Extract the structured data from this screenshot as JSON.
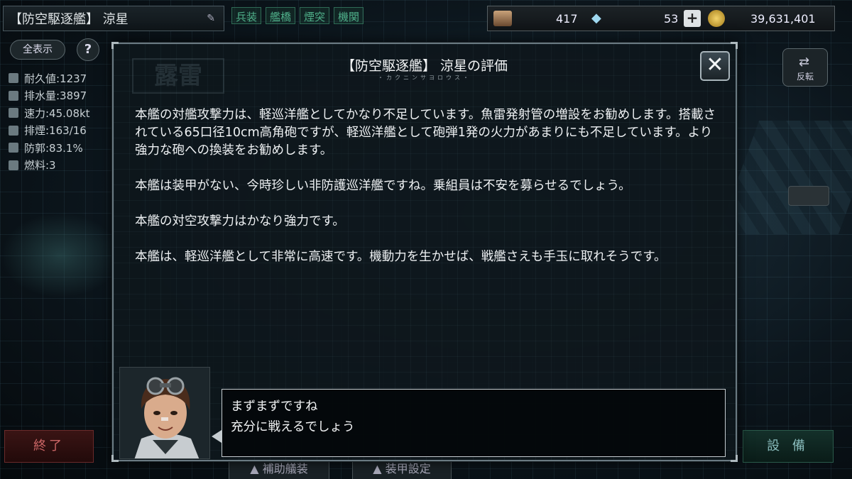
{
  "ship": {
    "name": "【防空駆逐艦】 涼星"
  },
  "category_tabs": [
    "兵装",
    "艦橋",
    "煙突",
    "機関"
  ],
  "resources": {
    "fuel": "417",
    "gems": "53",
    "add_symbol": "+",
    "coins": "39,631,401"
  },
  "controls": {
    "show_all": "全表示",
    "help": "?",
    "flip": "反転",
    "end": "終了",
    "equip": "設 備",
    "aux_equipment": "▲ 補助艤装",
    "armor_settings": "▲ 装甲設定"
  },
  "stats": [
    "耐久値:1237",
    "排水量:3897",
    "速力:45.08kt",
    "排煙:163/16",
    "防郭:83.1%",
    "燃料:3"
  ],
  "background_stamp": "露雷",
  "modal": {
    "title": "【防空駆逐艦】 涼星の評価",
    "subtitle": "・カクニンサヨロウス・",
    "close": "✕",
    "paragraphs": [
      "本艦の対艦攻撃力は、軽巡洋艦としてかなり不足しています。魚雷発射管の増設をお勧めします。搭載されている65口径10cm高角砲ですが、軽巡洋艦として砲弾1発の火力があまりにも不足しています。より強力な砲への換装をお勧めします。",
      "本艦は装甲がない、今時珍しい非防護巡洋艦ですね。乗組員は不安を募らせるでしょう。",
      "本艦の対空攻撃力はかなり強力です。",
      "本艦は、軽巡洋艦として非常に高速です。機動力を生かせば、戦艦さえも手玉に取れそうです。"
    ]
  },
  "dialogue": {
    "line1": "まずまずですね",
    "line2": "充分に戦えるでしょう"
  }
}
